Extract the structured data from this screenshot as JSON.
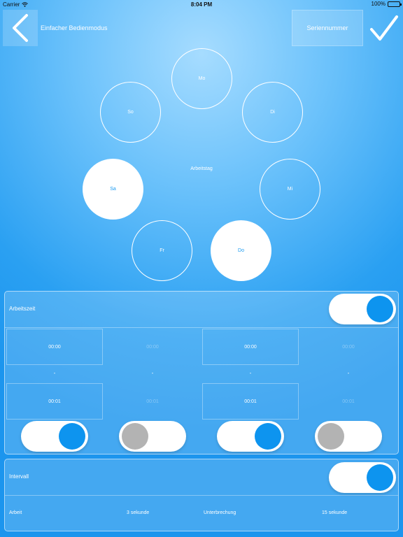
{
  "status_bar": {
    "carrier": "Carrier",
    "time": "8:04 PM",
    "battery": "100%"
  },
  "nav": {
    "title": "Einfacher Bedienmodus",
    "serial_label": "Seriennummer"
  },
  "days": {
    "center_label": "Arbeitstag",
    "mo": "Mo",
    "di": "Di",
    "mi": "Mi",
    "do": "Do",
    "fr": "Fr",
    "sa": "Sa",
    "so": "So"
  },
  "work_time": {
    "label": "Arbeitszeit",
    "start_times": [
      "00:00",
      "00:00",
      "00:00",
      "00:00"
    ],
    "separators": [
      "-",
      "-",
      "-",
      "-"
    ],
    "end_times": [
      "00:01",
      "00:01",
      "00:01",
      "00:01"
    ]
  },
  "interval": {
    "label": "Intervall",
    "work_label": "Arbeit",
    "work_value": "3 sekunde",
    "pause_label": "Unterbrechung",
    "pause_value": "15 sekunde"
  },
  "colors": {
    "accent": "#0d94ef",
    "switch_off": "#b3b3b3"
  }
}
